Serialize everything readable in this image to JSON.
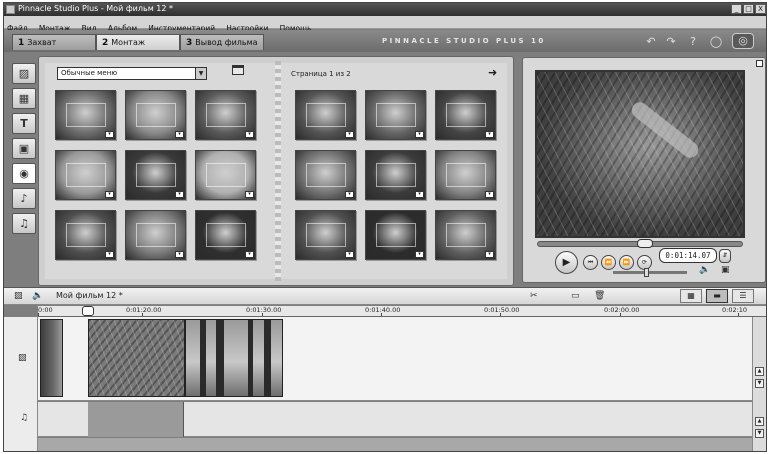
{
  "window": {
    "title": "Pinnacle Studio Plus - Мой фильм 12 *",
    "controls": [
      "_",
      "□",
      "X"
    ]
  },
  "menu": [
    "Файл",
    "Монтаж",
    "Вид",
    "Альбом",
    "Инструментарий",
    "Настройки",
    "Помощь"
  ],
  "tabs": [
    {
      "num": "1",
      "label": "Захват"
    },
    {
      "num": "2",
      "label": "Монтаж"
    },
    {
      "num": "3",
      "label": "Вывод фильма"
    }
  ],
  "brand": "PINNACLE STUDIO PLUS 10",
  "top_icons": [
    "undo-icon",
    "redo-icon",
    "help-icon",
    "hint-lamp-icon",
    "dvd-icon"
  ],
  "toolbox": {
    "icons": [
      "video-camera-icon",
      "transitions-icon",
      "title-icon",
      "photo-icon",
      "disc-menu-icon",
      "sound-icon",
      "music-icon"
    ],
    "active_index": 4
  },
  "album": {
    "theme_select": "Обычные меню",
    "page_label": "Страница 1 из 2",
    "left_thumbs": 9,
    "right_thumbs": 9,
    "thumb_colors": [
      "#6d6d6d",
      "#8a8a8a",
      "#5a5a5a",
      "#9b9b9b",
      "#3a3a3a",
      "#b0b0b0",
      "#4e4e4e",
      "#7c7c7c",
      "#2f2f2f",
      "#555555",
      "#666666",
      "#454545",
      "#737373",
      "#3c3c3c",
      "#858585",
      "#505050",
      "#2c2c2c",
      "#606060"
    ]
  },
  "player": {
    "timecode": "0:01:14.07",
    "scrub_fraction": 0.52,
    "volume_fraction": 0.45
  },
  "timeline": {
    "project_name": "Мой фильм 12 *",
    "ruler_ticks": [
      "0:00",
      "0:01:20.00",
      "0:01:30.00",
      "0:01:40.00",
      "0:01:50.00",
      "0:02:00.00",
      "0:02:10"
    ],
    "view_modes": [
      "storyboard-view-icon",
      "timeline-view-icon",
      "text-view-icon"
    ],
    "active_view": 1
  },
  "colors": {
    "frame": "#7e7e7e",
    "panel": "#d9d9d9",
    "audio_clip": "#9a9a9a"
  }
}
